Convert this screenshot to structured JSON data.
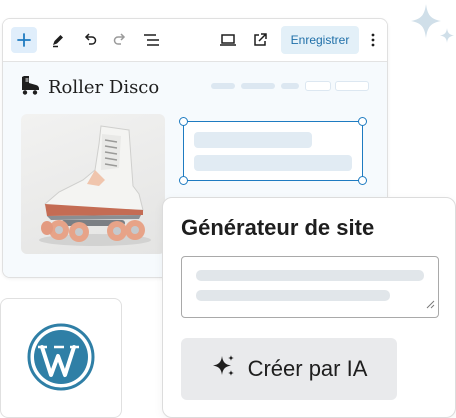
{
  "toolbar": {
    "save_label": "Enregistrer",
    "icons": [
      "plus-icon",
      "pen-icon",
      "undo-icon",
      "redo-icon",
      "list-view-icon",
      "laptop-icon",
      "external-link-icon",
      "more-vertical-icon"
    ]
  },
  "site": {
    "title": "Roller Disco",
    "logo_icon": "roller-skate-icon",
    "hero_image": "roller-skate-photo"
  },
  "generator": {
    "title": "Générateur de site",
    "button_label": "Créer par IA",
    "button_icon": "sparkle-icon"
  },
  "wordpress": {
    "logo": "wordpress-logo-icon"
  },
  "colors": {
    "accent": "#1e7bc1",
    "save_bg": "#e3f0f8",
    "save_text": "#1f6fa8",
    "wordpress_blue": "#2f7fa6",
    "sparkle": "#d0dfe9"
  }
}
